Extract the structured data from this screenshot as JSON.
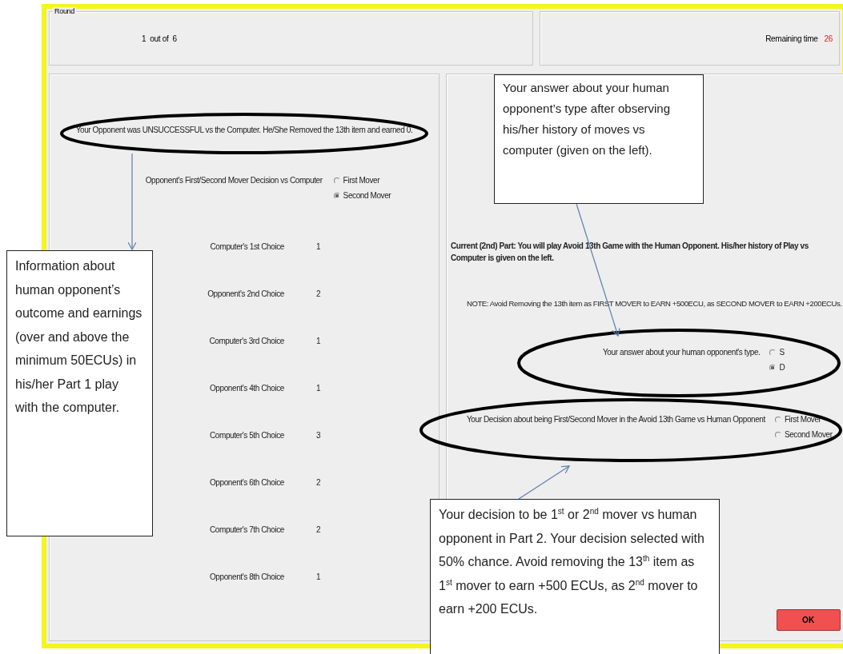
{
  "round": {
    "label": "Round",
    "counter": "1  out of  6",
    "remaining_label": "Remaining time",
    "remaining_value": "26"
  },
  "left": {
    "outcome": "Your Opponent was UNSUCCESSFUL vs the Computer. He/She Removed the 13th item and earned 0.",
    "decision": {
      "label": "Opponent's First/Second Mover Decision vs Computer",
      "options": [
        {
          "label": "First Mover",
          "selected": false
        },
        {
          "label": "Second Mover",
          "selected": true
        }
      ]
    },
    "choices": [
      {
        "label": "Computer's 1st Choice",
        "value": "1"
      },
      {
        "label": "Opponent's 2nd Choice",
        "value": "2"
      },
      {
        "label": "Computer's 3rd Choice",
        "value": "1"
      },
      {
        "label": "Opponent's 4th Choice",
        "value": "1"
      },
      {
        "label": "Computer's 5th Choice",
        "value": "3"
      },
      {
        "label": "Opponent's 6th Choice",
        "value": "2"
      },
      {
        "label": "Computer's 7th Choice",
        "value": "2"
      },
      {
        "label": "Opponent's 8th Choice",
        "value": "1"
      }
    ]
  },
  "right": {
    "intro": "Current (2nd) Part: You will play Avoid 13th Game with the Human Opponent. His/her history of Play vs Computer is given on the left.",
    "note": "NOTE: Avoid Removing the 13th item as  FIRST MOVER to EARN +500ECU, as SECOND MOVER to EARN +200ECUs.",
    "type_question": {
      "label": "Your answer about your human opponent's type.",
      "options": [
        {
          "label": "S",
          "selected": false
        },
        {
          "label": "D",
          "selected": true
        }
      ]
    },
    "mover_question": {
      "label": "Your Decision about being First/Second Mover in the Avoid 13th Game vs Human Opponent",
      "options": [
        {
          "label": "First Mover",
          "selected": false
        },
        {
          "label": "Second Mover",
          "selected": false
        }
      ]
    }
  },
  "ok_button": "OK",
  "callouts": [
    {
      "text": "Your answer about your human opponent’s type after observing his/her history of moves vs computer (given on the left)."
    },
    {
      "text": "Information about human opponent’s outcome and earnings (over and above the minimum 50ECUs) in his/her Part 1 play with the computer."
    },
    {
      "text": "Your decision to be 1$^{st}$ or 2$^{nd}$ mover vs human opponent in Part 2. Your decision selected with 50% chance. Avoid removing the 13$^{th}$ item as 1$^{st}$ mover to earn +500 ECUs, as 2$^{nd}$ mover to earn +200 ECUs."
    }
  ]
}
